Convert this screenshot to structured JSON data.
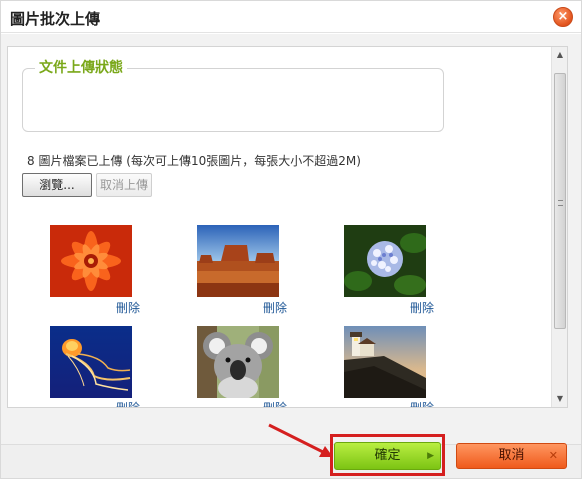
{
  "dialog": {
    "title": "圖片批次上傳",
    "close_glyph": "×"
  },
  "status_section": {
    "legend": "文件上傳狀態"
  },
  "upload_info": "8 圖片檔案已上傳 (每次可上傳10張圖片，每張大小不超過2M)",
  "buttons": {
    "browse_label": "瀏覽...",
    "cancel_upload_label": "取消上傳",
    "confirm_label": "確定",
    "cancel_label": "取消"
  },
  "thumbnails": [
    {
      "subject": "red-dahlia-flower",
      "delete_label": "刪除"
    },
    {
      "subject": "desert-butte",
      "delete_label": "刪除"
    },
    {
      "subject": "hydrangea",
      "delete_label": "刪除"
    },
    {
      "subject": "jellyfish",
      "delete_label": "刪除"
    },
    {
      "subject": "koala",
      "delete_label": "刪除"
    },
    {
      "subject": "lighthouse",
      "delete_label": "刪除"
    }
  ],
  "icons": {
    "close": "close-icon",
    "confirm_arrow": "arrow-right-icon",
    "cancel_x": "x-icon",
    "scroll_up": "▲",
    "scroll_down": "▼",
    "arrow_right": "▶",
    "x_mark": "✕"
  },
  "colors": {
    "legend": "#7aa81a",
    "confirm": "#8fd21f",
    "cancel": "#f26b2e",
    "highlight": "#d51f1f",
    "link": "#1f5796"
  }
}
